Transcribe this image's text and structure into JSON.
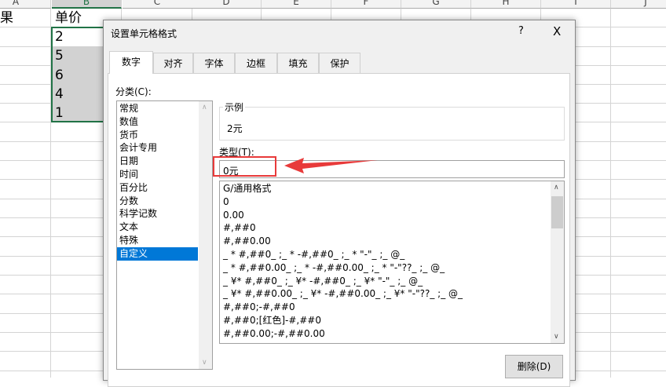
{
  "sheet": {
    "columns": [
      "A",
      "B",
      "C",
      "D",
      "E",
      "F",
      "G",
      "H",
      "I",
      "J"
    ],
    "a1": "果",
    "b1": "单价",
    "values": [
      "2",
      "5",
      "6",
      "4",
      "1"
    ],
    "selection_color": "#217346"
  },
  "dialog": {
    "title": "设置单元格格式",
    "help": "?",
    "close": "X",
    "tabs": [
      "数字",
      "对齐",
      "字体",
      "边框",
      "填充",
      "保护"
    ],
    "category_label": "分类(C):",
    "categories": [
      "常规",
      "数值",
      "货币",
      "会计专用",
      "日期",
      "时间",
      "百分比",
      "分数",
      "科学记数",
      "文本",
      "特殊",
      "自定义"
    ],
    "selected_category": "自定义",
    "sample_label": "示例",
    "sample_value": "2元",
    "type_label": "类型(T):",
    "type_value": "0元",
    "formats": [
      "G/通用格式",
      "0",
      "0.00",
      "#,##0",
      "#,##0.00",
      "_ * #,##0_ ;_ * -#,##0_ ;_ * \"-\"_ ;_ @_",
      "_ * #,##0.00_ ;_ * -#,##0.00_ ;_ * \"-\"??_ ;_ @_",
      "_ ¥* #,##0_ ;_ ¥* -#,##0_ ;_ ¥* \"-\"_ ;_ @_",
      "_ ¥* #,##0.00_ ;_ ¥* -#,##0.00_ ;_ ¥* \"-\"??_ ;_ @_",
      "#,##0;-#,##0",
      "#,##0;[红色]-#,##0",
      "#,##0.00;-#,##0.00"
    ],
    "delete_label": "删除(D)",
    "annotation_color": "#e83a3a"
  }
}
